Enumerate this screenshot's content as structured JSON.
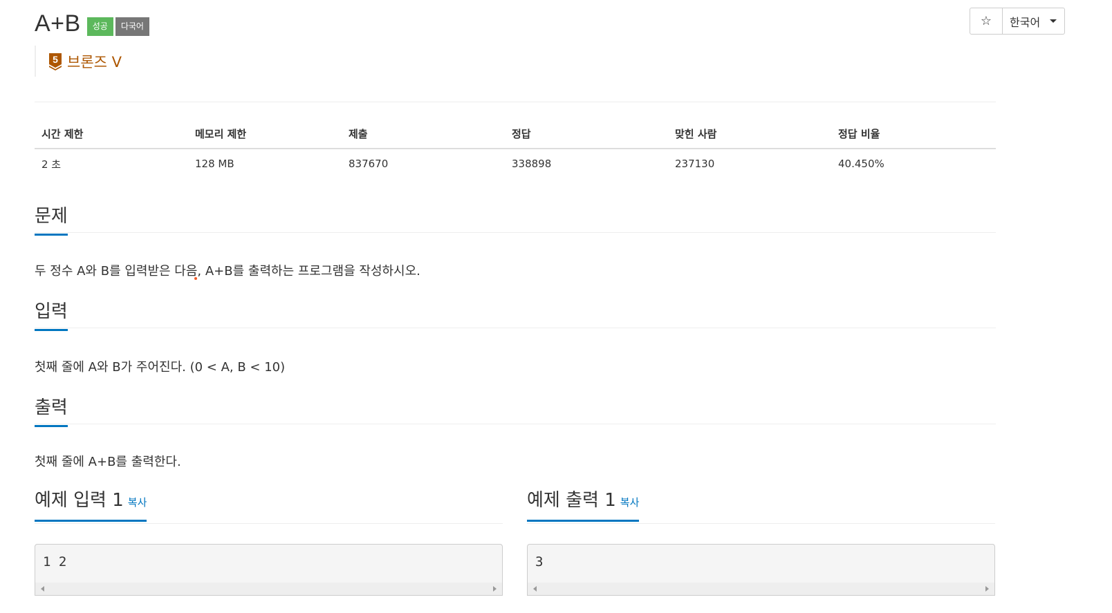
{
  "problem": {
    "title": "A+B",
    "badges": {
      "success": "성공",
      "multilang": "다국어"
    },
    "tier": {
      "label": "브론즈 V",
      "number": "5",
      "color": "#ad5600"
    }
  },
  "toolbar": {
    "star": "☆",
    "language": "한국어"
  },
  "stats": {
    "headers": [
      "시간 제한",
      "메모리 제한",
      "제출",
      "정답",
      "맞힌 사람",
      "정답 비율"
    ],
    "values": [
      "2 초",
      "128 MB",
      "837670",
      "338898",
      "237130",
      "40.450%"
    ]
  },
  "sections": {
    "description": {
      "heading": "문제",
      "text": "두 정수 A와 B를 입력받은 다음, A+B를 출력하는 프로그램을 작성하시오."
    },
    "input": {
      "heading": "입력",
      "text": "첫째 줄에 A와 B가 주어진다. (0 < A, B < 10)"
    },
    "output": {
      "heading": "출력",
      "text": "첫째 줄에 A+B를 출력한다."
    }
  },
  "samples": {
    "input": {
      "heading": "예제 입력 1",
      "copy": "복사",
      "content": "1 2"
    },
    "output": {
      "heading": "예제 출력 1",
      "copy": "복사",
      "content": "3"
    }
  },
  "colors": {
    "accent": "#0076c0",
    "success": "#5cb85c",
    "neutral": "#777777"
  }
}
